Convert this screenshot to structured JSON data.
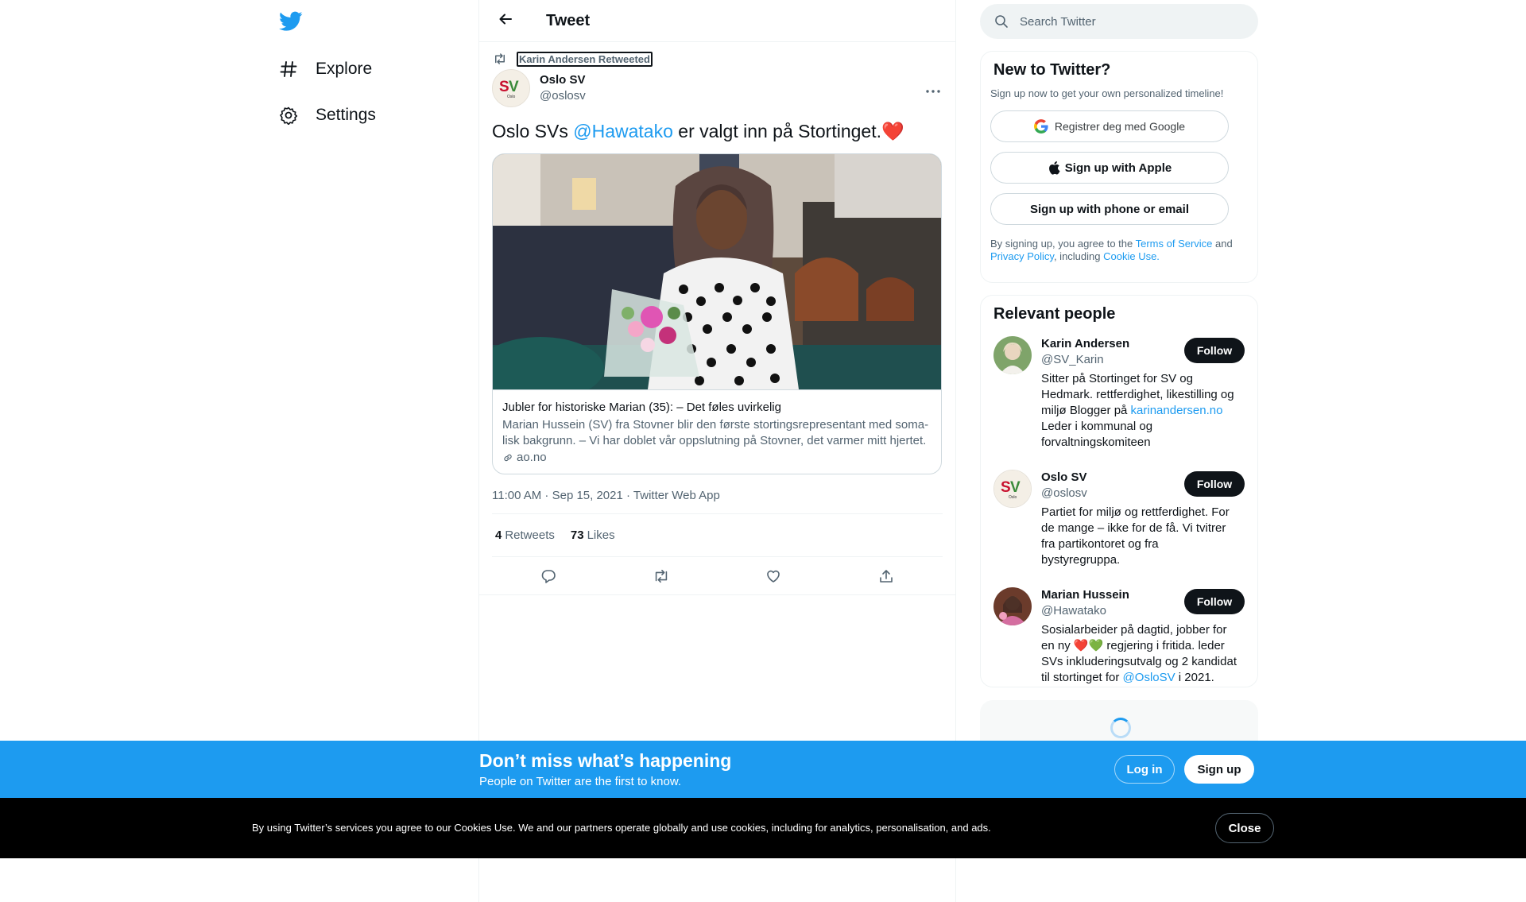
{
  "nav": {
    "items": [
      {
        "label": "Explore",
        "icon": "hashtag-icon"
      },
      {
        "label": "Settings",
        "icon": "gear-icon"
      }
    ]
  },
  "header": {
    "title": "Tweet"
  },
  "tweet": {
    "retweeted_by": "Karin Andersen Retweeted",
    "author_name": "Oslo SV",
    "author_handle": "@oslosv",
    "text_before": "Oslo SVs ",
    "mention": "@Hawatako",
    "text_after": " er valgt inn på Stortinget.",
    "emoji": "❤️",
    "card": {
      "title": "Jubler for historiske Marian (35): – Det føles uvirkelig",
      "description": "Marian Hussein (SV) fra Stovner blir den første stortingsrepresentant med soma­lisk bakgrunn. – Vi har doblet vår oppslutning på Stovner, det varmer mitt hjertet.",
      "domain": "ao.no"
    },
    "meta": "11:00 AM · Sep 15, 2021 · Twitter Web App",
    "retweets_count": "4",
    "retweets_label": "Retweets",
    "likes_count": "73",
    "likes_label": "Likes"
  },
  "search": {
    "placeholder": "Search Twitter"
  },
  "new_to_twitter": {
    "title": "New to Twitter?",
    "subtitle": "Sign up now to get your own personalized timeline!",
    "google_label": "Registrer deg med Google",
    "apple_label": "Sign up with Apple",
    "phone_label": "Sign up with phone or email",
    "terms_1": "By signing up, you agree to the ",
    "terms_link1": "Terms of Service",
    "terms_2": " and ",
    "terms_link2": "Privacy Policy",
    "terms_3": ", including ",
    "terms_link3": "Cookie Use."
  },
  "relevant": {
    "title": "Relevant people",
    "follow_label": "Follow",
    "people": [
      {
        "name": "Karin Andersen",
        "handle": "@SV_Karin",
        "bio": "Sitter på Stortinget for SV og Hedmark. rettferdighet, likestilling og miljø Blogger på ",
        "bio_link": "karinandersen.no",
        "bio_after": " Leder i kommunal og forvaltningskomiteen"
      },
      {
        "name": "Oslo SV",
        "handle": "@oslosv",
        "bio": "Partiet for miljø og rettferdighet. For de mange – ikke for de få. Vi tvitrer fra partikontoret og fra bystyregruppa."
      },
      {
        "name": "Marian Hussein",
        "handle": "@Hawatako",
        "bio": "Sosialarbeider på dagtid, jobber for en ny ",
        "bio_emoji": "❤️💚",
        "bio_mid": " regjering i fritida. leder SVs inkluderingsutvalg og 2 kandidat til stortinget for ",
        "bio_link": "@OsloSV",
        "bio_after": " i 2021."
      }
    ]
  },
  "signup_bar": {
    "title": "Don’t miss what’s happening",
    "subtitle": "People on Twitter are the first to know.",
    "login_label": "Log in",
    "signup_label": "Sign up"
  },
  "cookie_bar": {
    "text": "By using Twitter’s services you agree to our Cookies Use. We and our partners operate globally and use cookies, including for analytics, personalisation, and ads.",
    "close_label": "Close"
  },
  "colors": {
    "accent": "#1d9bf0",
    "text": "#0f1419",
    "secondary": "#536471"
  }
}
